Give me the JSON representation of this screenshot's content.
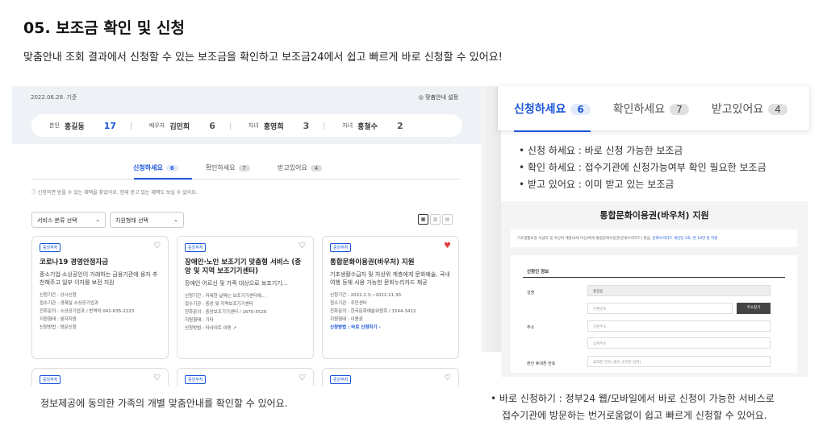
{
  "header": {
    "title": "05. 보조금 확인 및 신청",
    "subtitle": "맞춤안내 조회 결과에서 신청할 수 있는 보조금을 확인하고 보조금24에서 쉽고 빠르게 바로 신청할 수 있어요!"
  },
  "mock": {
    "date": "2022.06.28. 기준",
    "setting": "◎ 맞춤안내 설정",
    "family": [
      {
        "role": "본인",
        "name": "홍길동",
        "count": "17"
      },
      {
        "role": "배우자",
        "name": "김민희",
        "count": "6"
      },
      {
        "role": "자녀",
        "name": "홍영희",
        "count": "3"
      },
      {
        "role": "자녀",
        "name": "홍철수",
        "count": "2"
      }
    ],
    "tabs": [
      {
        "label": "신청하세요",
        "count": "6"
      },
      {
        "label": "확인하세요",
        "count": "7"
      },
      {
        "label": "받고있어요",
        "count": "4"
      }
    ],
    "info": "ⓘ 신청하면 받을 수 있는 혜택을 찾았어요. 현재 받고 있는 혜택도 보실 수 있어요.",
    "select1": "서비스 분류 선택",
    "select2": "지원형태 선택",
    "cards": [
      {
        "tag": "중앙부처",
        "title": "코로나19 경영안정자금",
        "desc": "중소기업·소상공인이 거래하는 금융기관에 융자 추천해주고 일부 이자를 보전 지원",
        "items": [
          "신청기간 : 상시신청",
          "접수기관 : 경제실 소상공기업과",
          "전화문의 : 소상공기업과 / 번역처 041-635-2223",
          "지원형태 : 융자지원",
          "신청방법 : 방문신청"
        ],
        "liked": false
      },
      {
        "tag": "중앙부처",
        "title": "장애인·노인 보조기기 맞춤형 서비스 (중앙 및 지역 보조기기센터)",
        "desc": "장애인·어르신 및 가족 대상으로 보조기기...",
        "items": [
          "신청기간 : 자세한 날짜는 보조기기센터에...",
          "접수기관 : 중앙 및 지역보조기기센터",
          "전화문의 : 중앙보조기기센터 / 1670-5529",
          "지원형태 : 기타",
          "신청방법 : 타사이트 이동 ↗"
        ],
        "liked": false
      },
      {
        "tag": "중앙부처",
        "title": "통합문화이용권(바우처) 지원",
        "desc": "기초생활수급자 및 차상위 계층에게 문화예술, 국내여행 등에 사용 가능한 문화누리카드 제공",
        "items": [
          "신청기간 : 2022.2.3.~2022.11.30.",
          "접수기관 : 주민센터",
          "전화문의 : 한국문화예술위원회 / 1544-3412",
          "지원형태 : 이용권",
          "신청방법 : 바로 신청하기 ›"
        ],
        "liked": true
      }
    ],
    "tags_row2": [
      "중앙부처",
      "중앙부처",
      "중앙부처"
    ]
  },
  "caption_left": "정보제공에 동의한 가족의 개별 맞춤안내를 확인할 수 있어요.",
  "big_tabs": [
    {
      "label": "신청하세요",
      "count": "6"
    },
    {
      "label": "확인하세요",
      "count": "7"
    },
    {
      "label": "받고있어요",
      "count": "4"
    }
  ],
  "bullets": [
    "신청 하세요 : 바로 신청 가능한 보조금",
    "확인 하세요 : 접수기관에 신청가능여부 확인 필요한 보조금",
    "받고 있어요 : 이미 받고 있는 보조금"
  ],
  "panel": {
    "title": "통합문화이용권(바우처) 지원",
    "notice": "기초생활보장 수급자 및 차상위 계층(6세 이상)에게 통합문화이용권(문화누리카드) 발급,",
    "notice_link": "문화누리카드 개인당 1회, 연 10만 원 지원",
    "section": "신청인 정보",
    "labels": {
      "name": "성명",
      "address": "주소",
      "phone": "본인 휴대폰 번호"
    },
    "name_value": "홍길동",
    "zip_placeholder": "우편번호",
    "search_btn": "주소찾기",
    "addr_placeholder": "기본주소",
    "detail_placeholder": "상세주소",
    "phone_placeholder": "휴대폰 번호(-없이 숫자만 입력)"
  },
  "caption_right": [
    "• 바로 신청하기 : 정부24 웹/모바일에서 바로 신청이 가능한 서비스로",
    "접수기관에 방문하는 번거로움없이 쉽고 빠르게 신청할 수 있어요."
  ]
}
